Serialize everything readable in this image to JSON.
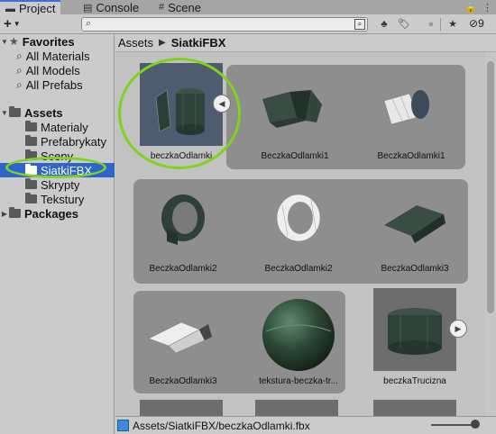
{
  "tabs": [
    {
      "label": "Project",
      "icon": "folder-icon"
    },
    {
      "label": "Console",
      "icon": "console-icon"
    },
    {
      "label": "Scene",
      "icon": "hash-icon"
    }
  ],
  "toolbar": {
    "add_label": "+",
    "search_value": "",
    "hidden_count": "9"
  },
  "tree": {
    "favorites": {
      "label": "Favorites",
      "items": [
        "All Materials",
        "All Models",
        "All Prefabs"
      ]
    },
    "assets": {
      "label": "Assets",
      "items": [
        "Materialy",
        "Prefabrykaty",
        "Sceny",
        "SiatkiFBX",
        "Skrypty",
        "Tekstury"
      ]
    },
    "packages": {
      "label": "Packages"
    }
  },
  "breadcrumb": {
    "root": "Assets",
    "current": "SiatkiFBX"
  },
  "assets": [
    {
      "label": "beczkaOdlamki"
    },
    {
      "label": "BeczkaOdlamki1"
    },
    {
      "label": "BeczkaOdlamki1"
    },
    {
      "label": "BeczkaOdlamki2"
    },
    {
      "label": "BeczkaOdlamki2"
    },
    {
      "label": "BeczkaOdlamki3"
    },
    {
      "label": "BeczkaOdlamki3"
    },
    {
      "label": "tekstura-beczka-tr..."
    },
    {
      "label": "beczkaTrucizna"
    }
  ],
  "status": {
    "path": "Assets/SiatkiFBX/beczkaOdlamki.fbx"
  },
  "colors": {
    "selection": "#2f65ca",
    "highlight": "#7cd41c",
    "tab_accent": "#3a72d8"
  }
}
